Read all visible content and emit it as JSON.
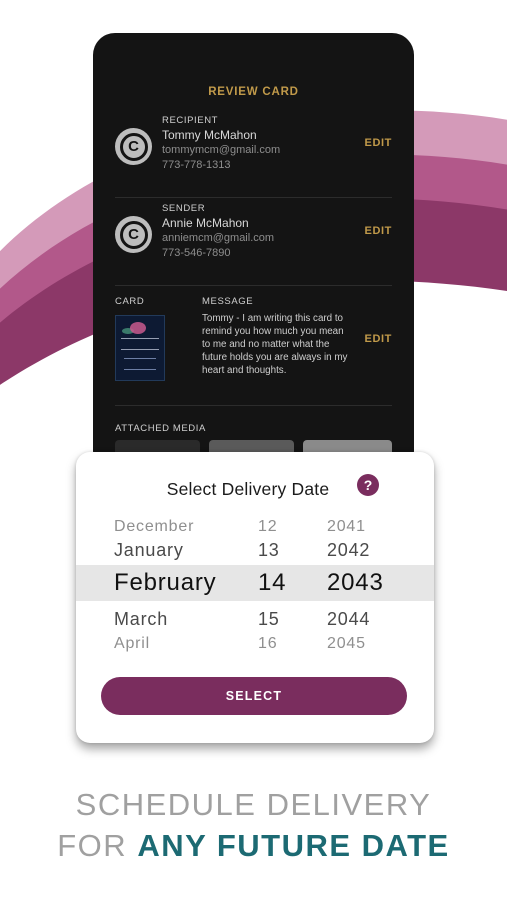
{
  "colors": {
    "accent_plum": "#7a2d5e",
    "gold": "#c19a4a",
    "teal": "#1c6a73",
    "phone_bg": "#141414"
  },
  "review": {
    "title": "REVIEW CARD",
    "recipient": {
      "label": "RECIPIENT",
      "avatar_letter": "C",
      "name": "Tommy McMahon",
      "email": "tommymcm@gmail.com",
      "phone": "773-778-1313",
      "edit": "EDIT"
    },
    "sender": {
      "label": "SENDER",
      "avatar_letter": "C",
      "name": "Annie McMahon",
      "email": "anniemcm@gmail.com",
      "phone": "773-546-7890",
      "edit": "EDIT"
    },
    "card_label": "CARD",
    "message_label": "MESSAGE",
    "message": "Tommy - I am writing this card to remind you how much you mean to me and no matter what the future holds you are always in my heart and thoughts.",
    "message_edit": "EDIT",
    "attached_media_label": "ATTACHED MEDIA"
  },
  "picker": {
    "title": "Select Delivery Date",
    "help_icon": "?",
    "rows": [
      {
        "month": "December",
        "day": "12",
        "year": "2041"
      },
      {
        "month": "January",
        "day": "13",
        "year": "2042"
      },
      {
        "month": "February",
        "day": "14",
        "year": "2043"
      },
      {
        "month": "March",
        "day": "15",
        "year": "2044"
      },
      {
        "month": "April",
        "day": "16",
        "year": "2045"
      }
    ],
    "selected_index": 2,
    "select_label": "SELECT"
  },
  "tagline": {
    "line1": "SCHEDULE DELIVERY",
    "line2_prefix": "FOR ",
    "line2_accent": "ANY FUTURE DATE"
  }
}
